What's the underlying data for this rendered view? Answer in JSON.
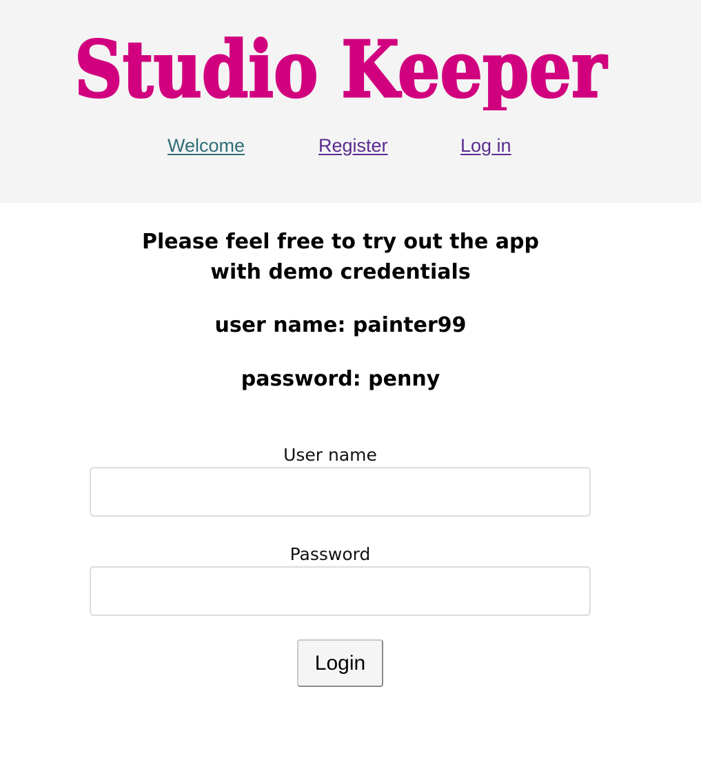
{
  "header": {
    "logo_text": "Studio Keeper",
    "logo_color": "#d1007e",
    "background": "#f4f4f4"
  },
  "nav": {
    "items": [
      {
        "label": "Welcome",
        "color": "#2f6e75"
      },
      {
        "label": "Register",
        "color": "#5a2b8f"
      },
      {
        "label": "Log in",
        "color": "#5a2b8f"
      }
    ]
  },
  "demo": {
    "line1": "Please feel free to try out the app",
    "line2": "with demo credentials",
    "username_line": "user name: painter99",
    "password_line": "password: penny"
  },
  "form": {
    "username_label": "User name",
    "username_value": "",
    "password_label": "Password",
    "password_value": "",
    "submit_label": "Login"
  }
}
